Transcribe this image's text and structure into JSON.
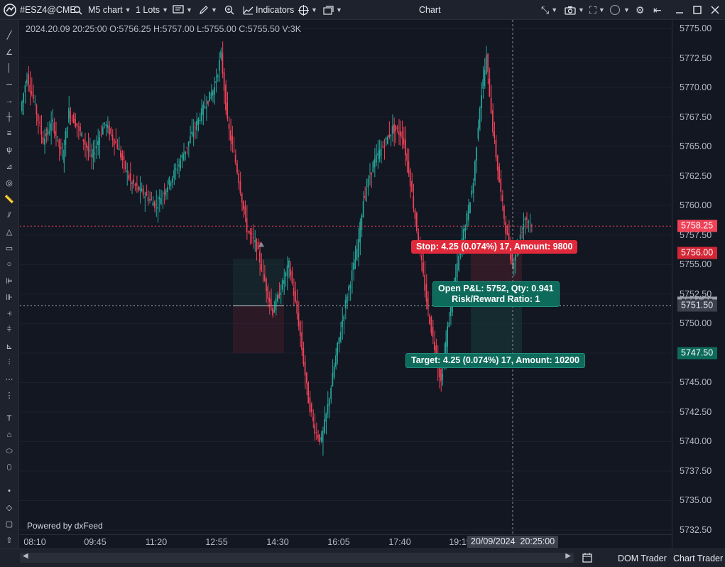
{
  "toolbar": {
    "symbol": "#ESZ4@CME",
    "interval": "M5 chart",
    "lots": "1 Lots",
    "indicators": "Indicators",
    "window_title": "Chart"
  },
  "legend": {
    "ohlc": "2024.20.09 20:25:00 O:5756.25 H:5757.00 L:5755.00 C:5755.50 V:3K"
  },
  "powered_by": "Powered by dxFeed",
  "price_axis": {
    "ticks": [
      "5775.00",
      "5772.50",
      "5770.00",
      "5767.50",
      "5765.00",
      "5762.50",
      "5760.00",
      "5757.50",
      "5755.00",
      "5752.50",
      "5750.00",
      "5747.50",
      "5745.00",
      "5742.50",
      "5740.00",
      "5737.50",
      "5735.00",
      "5732.50"
    ],
    "labels": {
      "stop": "5758.25",
      "current": "5756.00",
      "entry_crosshair": "5751.75",
      "entry": "5751.50",
      "target": "5747.50"
    }
  },
  "time_axis": {
    "ticks": [
      "08:10",
      "09:45",
      "11:20",
      "12:55",
      "14:30",
      "16:05",
      "17:40",
      "19:15"
    ],
    "crosshair_label": "20/09/2024  20:25:00"
  },
  "position": {
    "stop_text": "Stop: 4.25 (0.074%) 17, Amount: 9800",
    "pnl_text": "Open P&L: 5752, Qty: 0.941",
    "rr_text": "Risk/Reward Ratio: 1",
    "target_text": "Target: 4.25 (0.074%) 17, Amount: 10200"
  },
  "bottom_bar": {
    "dom_trader": "DOM Trader",
    "chart_trader": "Chart Trader"
  },
  "colors": {
    "up": "#26a69a",
    "down": "#ef4257",
    "background": "#131722",
    "panel": "#1e222d"
  },
  "chart_data": {
    "type": "candlestick",
    "symbol": "#ESZ4@CME",
    "interval": "M5",
    "ylim": [
      5732.0,
      5776.0
    ],
    "x_ticks": [
      "08:10",
      "09:45",
      "11:20",
      "12:55",
      "14:30",
      "16:05",
      "17:40",
      "19:15"
    ],
    "stop_level": 5758.25,
    "entry_level": 5751.5,
    "target_level": 5747.5,
    "last_price": 5756.0,
    "path": [
      [
        0,
        5768.0
      ],
      [
        4,
        5771.0
      ],
      [
        8,
        5769.0
      ],
      [
        14,
        5765.5
      ],
      [
        20,
        5767.0
      ],
      [
        26,
        5764.0
      ],
      [
        30,
        5768.0
      ],
      [
        36,
        5766.5
      ],
      [
        44,
        5764.0
      ],
      [
        52,
        5767.0
      ],
      [
        60,
        5765.0
      ],
      [
        68,
        5762.0
      ],
      [
        76,
        5761.0
      ],
      [
        84,
        5760.0
      ],
      [
        90,
        5761.5
      ],
      [
        98,
        5763.5
      ],
      [
        106,
        5766.0
      ],
      [
        114,
        5768.5
      ],
      [
        120,
        5770.0
      ],
      [
        124,
        5772.8
      ],
      [
        128,
        5767.0
      ],
      [
        134,
        5763.0
      ],
      [
        140,
        5758.0
      ],
      [
        146,
        5756.5
      ],
      [
        152,
        5753.0
      ],
      [
        156,
        5751.0
      ],
      [
        160,
        5752.5
      ],
      [
        166,
        5755.0
      ],
      [
        172,
        5750.0
      ],
      [
        178,
        5743.5
      ],
      [
        182,
        5741.0
      ],
      [
        186,
        5740.0
      ],
      [
        190,
        5743.0
      ],
      [
        196,
        5748.0
      ],
      [
        202,
        5752.5
      ],
      [
        208,
        5756.0
      ],
      [
        212,
        5760.5
      ],
      [
        218,
        5763.5
      ],
      [
        224,
        5765.0
      ],
      [
        230,
        5766.5
      ],
      [
        236,
        5766.0
      ],
      [
        240,
        5763.0
      ],
      [
        244,
        5759.0
      ],
      [
        248,
        5755.0
      ],
      [
        252,
        5751.0
      ],
      [
        256,
        5748.0
      ],
      [
        260,
        5745.0
      ],
      [
        264,
        5749.5
      ],
      [
        268,
        5753.0
      ],
      [
        272,
        5756.5
      ],
      [
        276,
        5759.0
      ],
      [
        280,
        5762.0
      ],
      [
        284,
        5768.5
      ],
      [
        288,
        5772.5
      ],
      [
        292,
        5766.5
      ],
      [
        296,
        5762.0
      ],
      [
        300,
        5758.0
      ],
      [
        304,
        5755.0
      ],
      [
        308,
        5757.0
      ],
      [
        312,
        5759.0
      ],
      [
        316,
        5758.5
      ]
    ]
  }
}
